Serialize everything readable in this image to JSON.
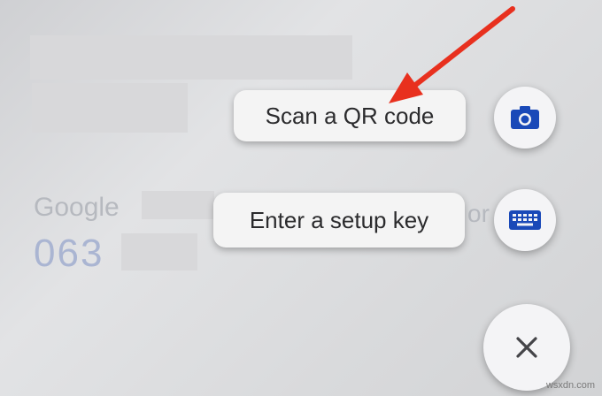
{
  "menu": {
    "scan_qr_label": "Scan a QR code",
    "setup_key_label": "Enter a setup key"
  },
  "background": {
    "account_provider": "Google",
    "code_prefix": "063",
    "cut_off_text": "or"
  },
  "icons": {
    "camera": "camera-icon",
    "keyboard": "keyboard-icon",
    "close": "close-icon",
    "accent_color": "#1a49b8"
  },
  "watermark": "wsxdn.com"
}
